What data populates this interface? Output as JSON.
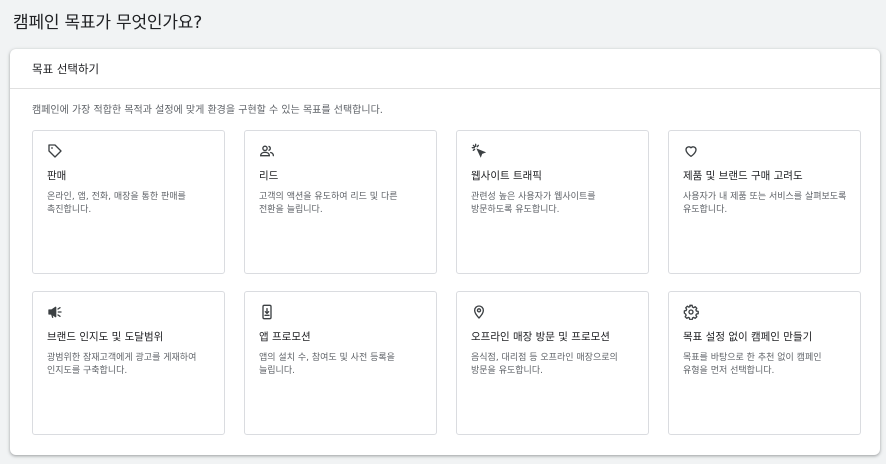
{
  "page": {
    "title": "캠페인 목표가 무엇인가요?"
  },
  "panel": {
    "header": "목표 선택하기",
    "description": "캠페인에 가장 적합한 목적과 설정에 맞게 환경을 구현할 수 있는 목표를 선택합니다."
  },
  "goals": [
    {
      "icon": "tag-icon",
      "title": "판매",
      "description": "온라인, 앱, 전화, 매장을 통한 판매를 촉진합니다."
    },
    {
      "icon": "people-icon",
      "title": "리드",
      "description": "고객의 액션을 유도하여 리드 및 다른 전환을 늘립니다."
    },
    {
      "icon": "cursor-click-icon",
      "title": "웹사이트 트래픽",
      "description": "관련성 높은 사용자가 웹사이트를 방문하도록 유도합니다."
    },
    {
      "icon": "heart-icon",
      "title": "제품 및 브랜드 구매 고려도",
      "description": "사용자가 내 제품 또는 서비스를 살펴보도록 유도합니다."
    },
    {
      "icon": "megaphone-icon",
      "title": "브랜드 인지도 및 도달범위",
      "description": "광범위한 잠재고객에게 광고를 게재하여 인지도를 구축합니다."
    },
    {
      "icon": "phone-download-icon",
      "title": "앱 프로모션",
      "description": "앱의 설치 수, 참여도 및 사전 등록을 늘립니다."
    },
    {
      "icon": "location-pin-icon",
      "title": "오프라인 매장 방문 및 프로모션",
      "description": "음식점, 대리점 등 오프라인 매장으로의 방문을 유도합니다."
    },
    {
      "icon": "gear-icon",
      "title": "목표 설정 없이 캠페인 만들기",
      "description": "목표를 바탕으로 한 추천 없이 캠페인 유형을 먼저 선택합니다."
    }
  ]
}
